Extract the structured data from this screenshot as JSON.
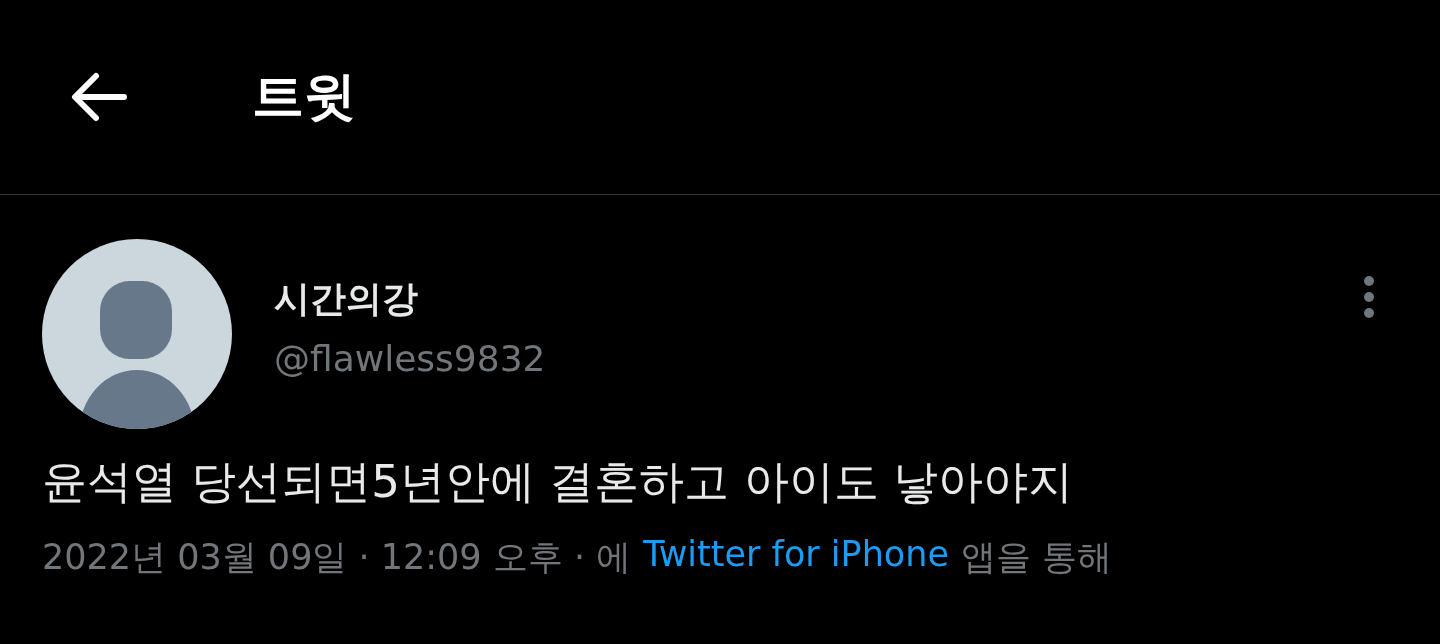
{
  "header": {
    "title": "트윗"
  },
  "tweet": {
    "author": {
      "name": "시간의강",
      "handle": "@flawless9832"
    },
    "text": "윤석열 당선되면5년안에 결혼하고 아이도 낳아야지",
    "meta": {
      "timestamp": "2022년 03월 09일 · 12:09 오후 · 에",
      "source": "Twitter for iPhone",
      "suffix": "앱을 통해"
    }
  }
}
